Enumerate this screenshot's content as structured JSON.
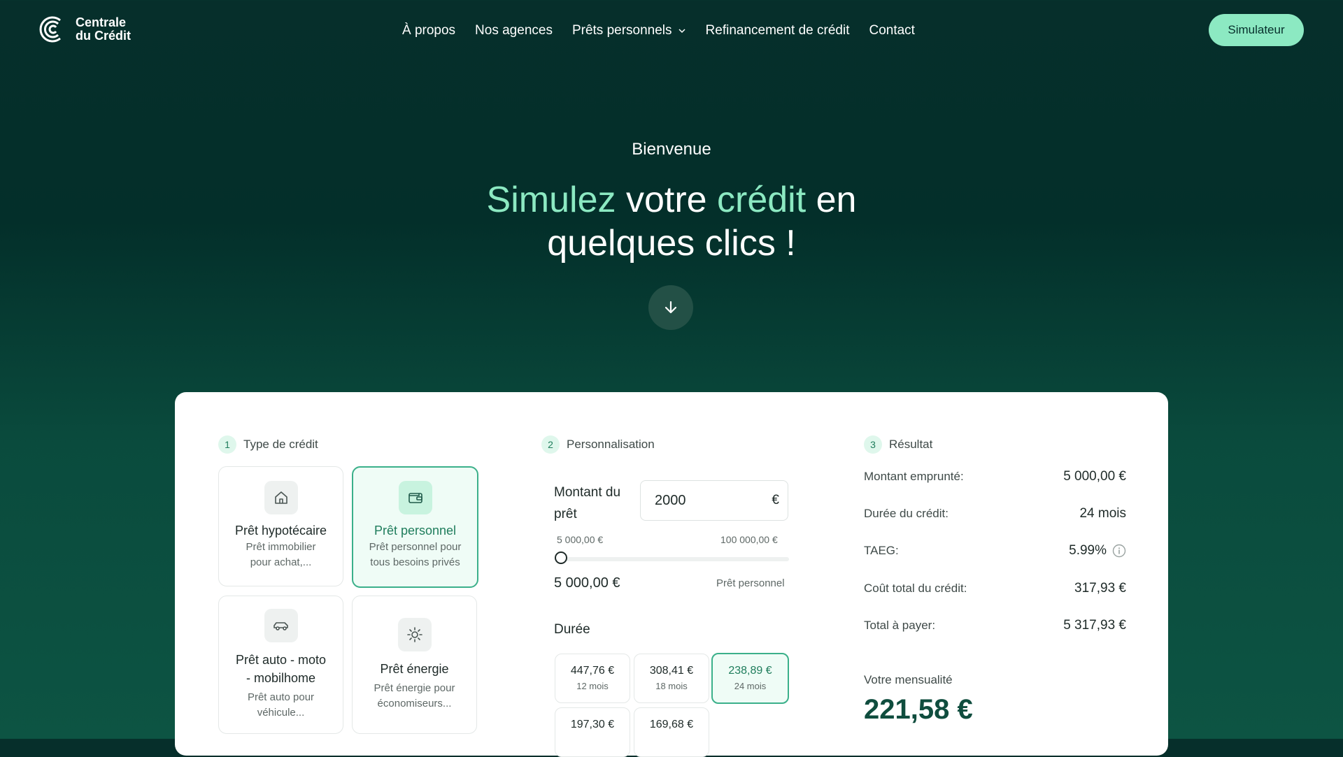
{
  "brand": {
    "line1": "Centrale",
    "line2": "du Crédit"
  },
  "nav": [
    {
      "label": "À propos"
    },
    {
      "label": "Nos agences"
    },
    {
      "label": "Prêts personnels"
    },
    {
      "label": "Refinancement de crédit"
    },
    {
      "label": "Contact"
    }
  ],
  "header": {
    "cta": "Simulateur"
  },
  "hero": {
    "welcome": "Bienvenue",
    "title_part1": "Simulez",
    "title_part2": " votre ",
    "title_part3": "crédit",
    "title_part4": " en",
    "title_line2": "quelques clics !"
  },
  "steps": {
    "type": {
      "num": "1",
      "label": "Type de crédit"
    },
    "perso": {
      "num": "2",
      "label": "Personnalisation"
    },
    "result": {
      "num": "3",
      "label": "Résultat"
    }
  },
  "credit_types": [
    {
      "title": "Prêt hypotécaire",
      "desc1": "Prêt immobilier",
      "desc2": "pour achat,...",
      "icon": "home-icon",
      "selected": false
    },
    {
      "title": "Prêt personnel",
      "desc1": "Prêt personnel pour",
      "desc2": "tous besoins privés",
      "icon": "wallet-icon",
      "selected": true
    },
    {
      "title1": "Prêt auto - moto",
      "title2": "- mobilhome",
      "desc1": "Prêt auto pour",
      "desc2": "véhicule...",
      "icon": "car-icon",
      "selected": false
    },
    {
      "title": "Prêt énergie",
      "desc1": "Prêt énergie pour",
      "desc2": "économiseurs...",
      "icon": "sun-icon",
      "selected": false
    }
  ],
  "personalisation": {
    "amount_label1": "Montant du",
    "amount_label2": "prêt",
    "amount_value": "2000",
    "currency": "€",
    "slider_min": "5 000,00 €",
    "slider_max": "100 000,00 €",
    "slider_level": 0,
    "current_amount": "5 000,00 €",
    "loan_type": "Prêt personnel",
    "duration_label": "Durée",
    "durations": [
      {
        "amount": "447,76 €",
        "months": "12 mois",
        "selected": false
      },
      {
        "amount": "308,41 €",
        "months": "18 mois",
        "selected": false
      },
      {
        "amount": "238,89 €",
        "months": "24 mois",
        "selected": true
      },
      {
        "amount": "197,30 €",
        "months": "",
        "selected": false
      },
      {
        "amount": "169,68 €",
        "months": "",
        "selected": false
      }
    ]
  },
  "result": {
    "rows": [
      {
        "label": "Montant emprunté:",
        "value": "5 000,00 €"
      },
      {
        "label": "Durée du crédit:",
        "value": "24 mois"
      },
      {
        "label": "TAEG:",
        "value": "5.99%"
      },
      {
        "label": "Coût total du crédit:",
        "value": "317,93 €"
      },
      {
        "label": "Total à payer:",
        "value": "5 317,93 €"
      }
    ],
    "monthly_label": "Votre mensualité",
    "monthly_value": "221,58 €"
  },
  "colors": {
    "accent": "#8ce9c2",
    "dark": "#062f2b",
    "selected_border": "#3bb08a"
  }
}
